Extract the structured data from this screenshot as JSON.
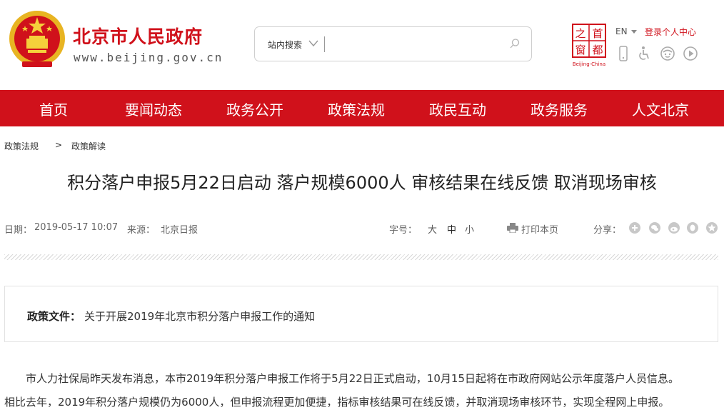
{
  "header": {
    "site_name": "北京市人民政府",
    "site_url": "www.beijing.gov.cn",
    "search_scope": "站内搜索",
    "search_placeholder": "",
    "lang": "EN",
    "login_link": "登录个人中心",
    "logo_chars": [
      "之",
      "首",
      "窗",
      "都"
    ],
    "logo_caption": "Beijing-China",
    "tool_icons": [
      "mobile-icon",
      "accessibility-icon",
      "elderly-icon",
      "play-icon"
    ]
  },
  "nav": {
    "items": [
      "首页",
      "要闻动态",
      "政务公开",
      "政策法规",
      "政民互动",
      "政务服务",
      "人文北京"
    ]
  },
  "breadcrumb": {
    "items": [
      "政策法规",
      "政策解读"
    ],
    "separator": ">"
  },
  "article": {
    "title": "积分落户申报5月22日启动 落户规模6000人 审核结果在线反馈 取消现场审核",
    "date_label": "日期：",
    "date": "2019-05-17 10:07",
    "source_label": "来源：",
    "source": "北京日报",
    "font_size_label": "字号：",
    "font_sizes": [
      "大",
      "中",
      "小"
    ],
    "print_label": "打印本页",
    "share_label": "分享：",
    "share_icons": [
      "plus-share-icon",
      "wechat-icon",
      "weibo-icon",
      "qq-icon",
      "star-icon"
    ],
    "policy_label": "政策文件：",
    "policy_link": "关于开展2019年北京市积分落户申报工作的通知",
    "paragraphs": [
      "　　市人力社保局昨天发布消息，本市2019年积分落户申报工作将于5月22日正式启动，10月15日起将在市政府网站公示年度落户人员信息。",
      "相比去年，2019年积分落户规模仍为6000人，但申报流程更加便捷，指标审核结果可在线反馈，并取消现场审核环节，实现全程网上申报。"
    ]
  },
  "colors": {
    "brand_red": "#d0111b",
    "emblem_gold": "#e8b422"
  }
}
